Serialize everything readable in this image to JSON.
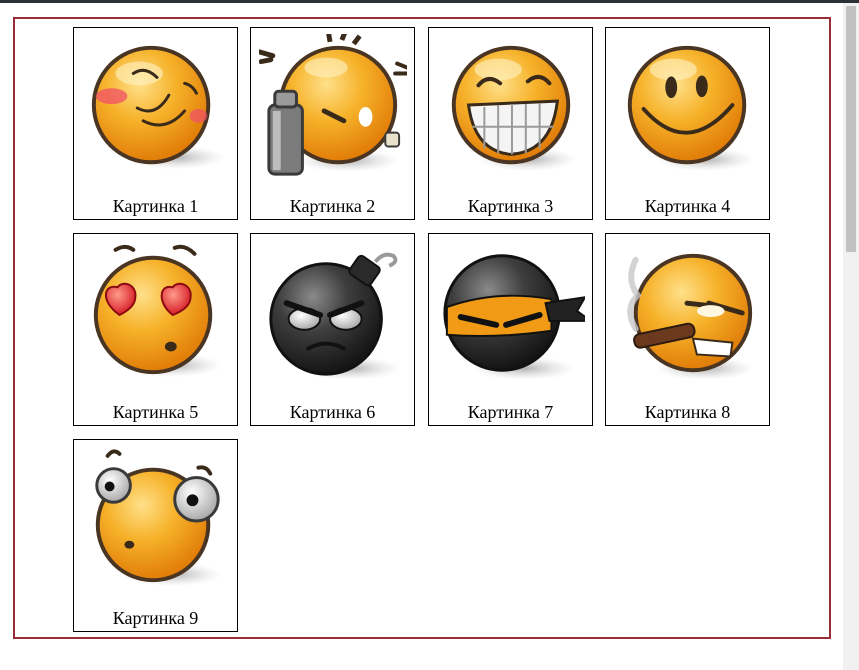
{
  "gallery": {
    "items": [
      {
        "caption": "Картинка 1",
        "icon": "blushing-wink-smiley-icon"
      },
      {
        "caption": "Картинка 2",
        "icon": "graffiti-spray-smiley-icon"
      },
      {
        "caption": "Картинка 3",
        "icon": "big-grin-smiley-icon"
      },
      {
        "caption": "Картинка 4",
        "icon": "smile-smiley-icon"
      },
      {
        "caption": "Картинка 5",
        "icon": "heart-eyes-smiley-icon"
      },
      {
        "caption": "Картинка 6",
        "icon": "angry-bomb-icon"
      },
      {
        "caption": "Картинка 7",
        "icon": "ninja-smiley-icon"
      },
      {
        "caption": "Картинка 8",
        "icon": "cigar-smiley-icon"
      },
      {
        "caption": "Картинка 9",
        "icon": "shocked-smiley-icon"
      }
    ]
  },
  "colors": {
    "frame_border": "#9b2d35",
    "smiley_orange": "#f2a11b",
    "bomb_dark": "#3a3a3a"
  }
}
